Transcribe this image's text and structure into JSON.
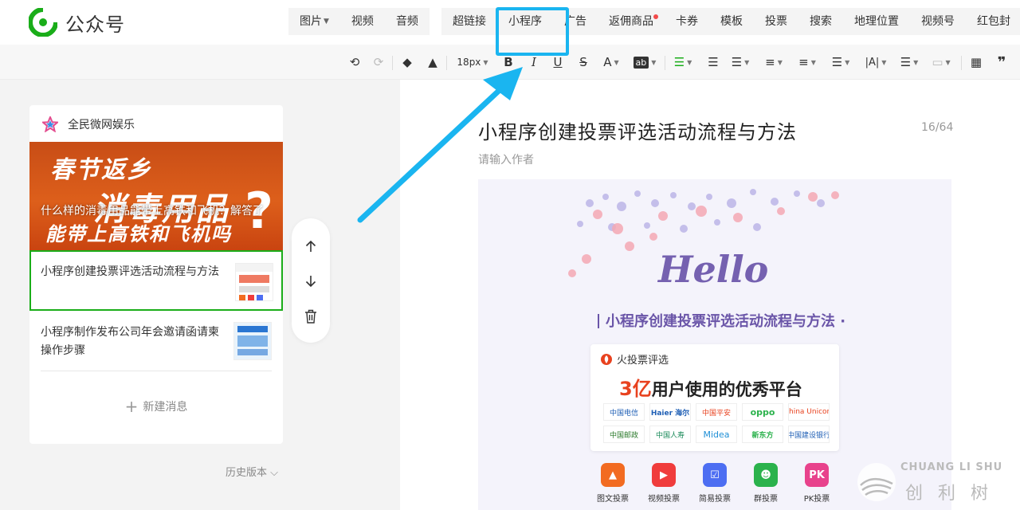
{
  "app": {
    "title": "公众号"
  },
  "nav": {
    "group1": [
      {
        "label": "图片",
        "has_caret": true
      },
      {
        "label": "视频"
      },
      {
        "label": "音频"
      }
    ],
    "group2": [
      {
        "label": "超链接"
      },
      {
        "label": "小程序"
      },
      {
        "label": "广告"
      },
      {
        "label": "返佣商品",
        "dot": true
      },
      {
        "label": "卡券"
      },
      {
        "label": "模板"
      },
      {
        "label": "投票"
      },
      {
        "label": "搜索"
      },
      {
        "label": "地理位置"
      },
      {
        "label": "视频号"
      },
      {
        "label": "红包封"
      }
    ]
  },
  "toolbar": {
    "font_size": "18px",
    "bold": "B",
    "italic": "I",
    "underline": "U",
    "strike": "S",
    "font_color": "A",
    "bg_label": "ab",
    "letter_spacing": "|A|",
    "accent_color": "#1aad19"
  },
  "sidebar": {
    "account_name": "全民微网娱乐",
    "cover": {
      "line1": "春节返乡",
      "line2": "消毒用品",
      "line3": "能带上高铁和飞机吗",
      "question_mark": "?",
      "caption": "什么样的消毒用品能带上高铁和飞机？解答了"
    },
    "messages": [
      {
        "title": "小程序创建投票评选活动流程与方法",
        "active": true
      },
      {
        "title": "小程序制作发布公司年会邀请函请柬操作步骤",
        "active": false
      }
    ],
    "new_message": "新建消息",
    "history": "历史版本"
  },
  "editor": {
    "title": "小程序创建投票评选活动流程与方法",
    "title_count": "16/64",
    "author_placeholder": "请输入作者",
    "image": {
      "hello": "Hello",
      "subhead": "小程序创建投票评选活动流程与方法 ·",
      "brand": "火投票评选",
      "slogan_number": "3亿",
      "slogan_text": "用户使用的优秀平台",
      "logos": [
        "中国电信",
        "Haier 海尔",
        "中国平安",
        "oppo",
        "China Unicom",
        "中国邮政",
        "中国人寿",
        "Midea",
        "新东方",
        "中国建设银行"
      ],
      "apps": [
        {
          "label": "图文投票",
          "color": "#f26b21"
        },
        {
          "label": "视频投票",
          "color": "#f03c3c"
        },
        {
          "label": "简易投票",
          "color": "#4d6ef2"
        },
        {
          "label": "群投票",
          "color": "#2bb24c"
        },
        {
          "label": "PK投票",
          "color": "#e8428c"
        }
      ]
    }
  },
  "watermark": {
    "en": "CHUANG LI SHU",
    "cn": "创 利 树"
  }
}
